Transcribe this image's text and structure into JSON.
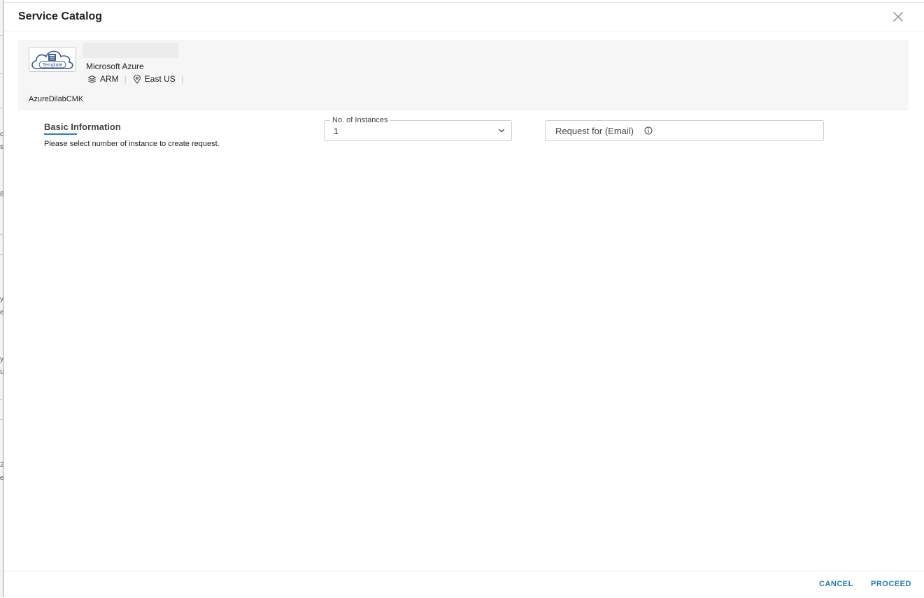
{
  "modal": {
    "title": "Service Catalog"
  },
  "summary": {
    "icon_label": "Template",
    "provider": "Microsoft Azure",
    "deployment_type": "ARM",
    "region": "East US",
    "template_name": "AzureDilabCMK"
  },
  "basic_info": {
    "title": "Basic Information",
    "help_text": "Please select number of instance to create request."
  },
  "instances": {
    "label": "No. of Instances",
    "value": "1"
  },
  "email": {
    "placeholder": "Request for (Email)"
  },
  "footer": {
    "cancel_label": "CANCEL",
    "proceed_label": "PROCEED"
  },
  "colors": {
    "accent": "#1f78b4",
    "tab_underline": "#2a7fc1",
    "icon_blue": "#3b5a8c"
  },
  "icons": [
    "close-icon",
    "cloud-template-icon",
    "layers-icon",
    "location-pin-icon",
    "chevron-down-icon",
    "info-icon"
  ]
}
